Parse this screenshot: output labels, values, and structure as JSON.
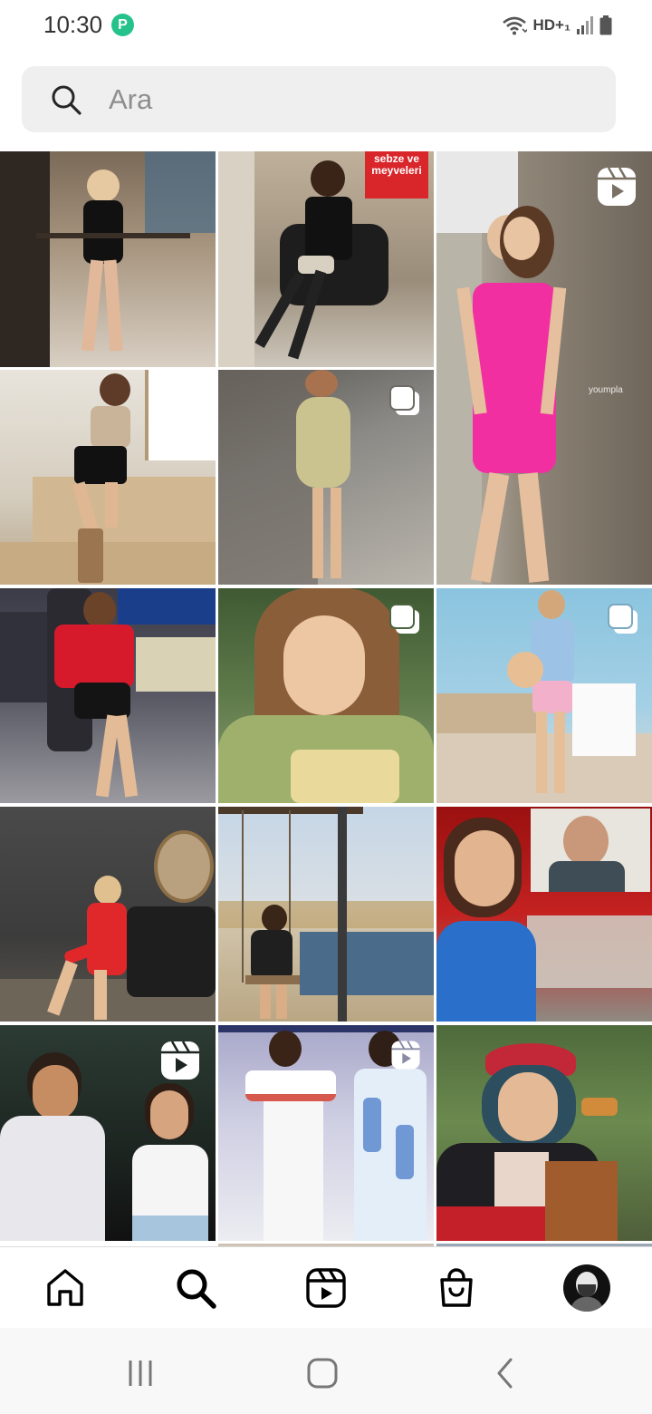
{
  "status_bar": {
    "time": "10:30",
    "app_badge_letter": "P",
    "network_label": "HD+₁"
  },
  "search": {
    "placeholder": "Ara",
    "value": ""
  },
  "grid": {
    "tiles": [
      {
        "id": "t1",
        "badge": "none",
        "overlay_text": ""
      },
      {
        "id": "t2",
        "badge": "none",
        "overlay_text": "sebze ve meyveleri"
      },
      {
        "id": "t3",
        "badge": "reels",
        "overlay_text": "youmpla"
      },
      {
        "id": "t4",
        "badge": "none",
        "overlay_text": ""
      },
      {
        "id": "t5",
        "badge": "carousel",
        "overlay_text": ""
      },
      {
        "id": "t6",
        "badge": "none",
        "overlay_text": ""
      },
      {
        "id": "t7",
        "badge": "carousel",
        "overlay_text": ""
      },
      {
        "id": "t8",
        "badge": "carousel",
        "overlay_text": ""
      },
      {
        "id": "t9",
        "badge": "none",
        "overlay_text": ""
      },
      {
        "id": "t10",
        "badge": "none",
        "overlay_text": ""
      },
      {
        "id": "t11",
        "badge": "none",
        "overlay_text": ""
      },
      {
        "id": "t12",
        "badge": "reels",
        "overlay_text": ""
      },
      {
        "id": "t13",
        "badge": "reels",
        "overlay_text": ""
      },
      {
        "id": "t14",
        "badge": "none",
        "overlay_text": ""
      }
    ]
  },
  "bottom_nav": {
    "items": [
      {
        "icon": "home-icon",
        "active": false
      },
      {
        "icon": "search-icon",
        "active": true
      },
      {
        "icon": "reels-icon",
        "active": false
      },
      {
        "icon": "shop-icon",
        "active": false
      },
      {
        "icon": "profile-avatar",
        "active": false
      }
    ]
  },
  "system_nav": {
    "buttons": [
      "recents-icon",
      "home-button-icon",
      "back-icon"
    ]
  },
  "colors": {
    "accent": "#25c28b",
    "search_bg": "#efefef",
    "placeholder": "#8e8e8e",
    "icon": "#000000"
  }
}
